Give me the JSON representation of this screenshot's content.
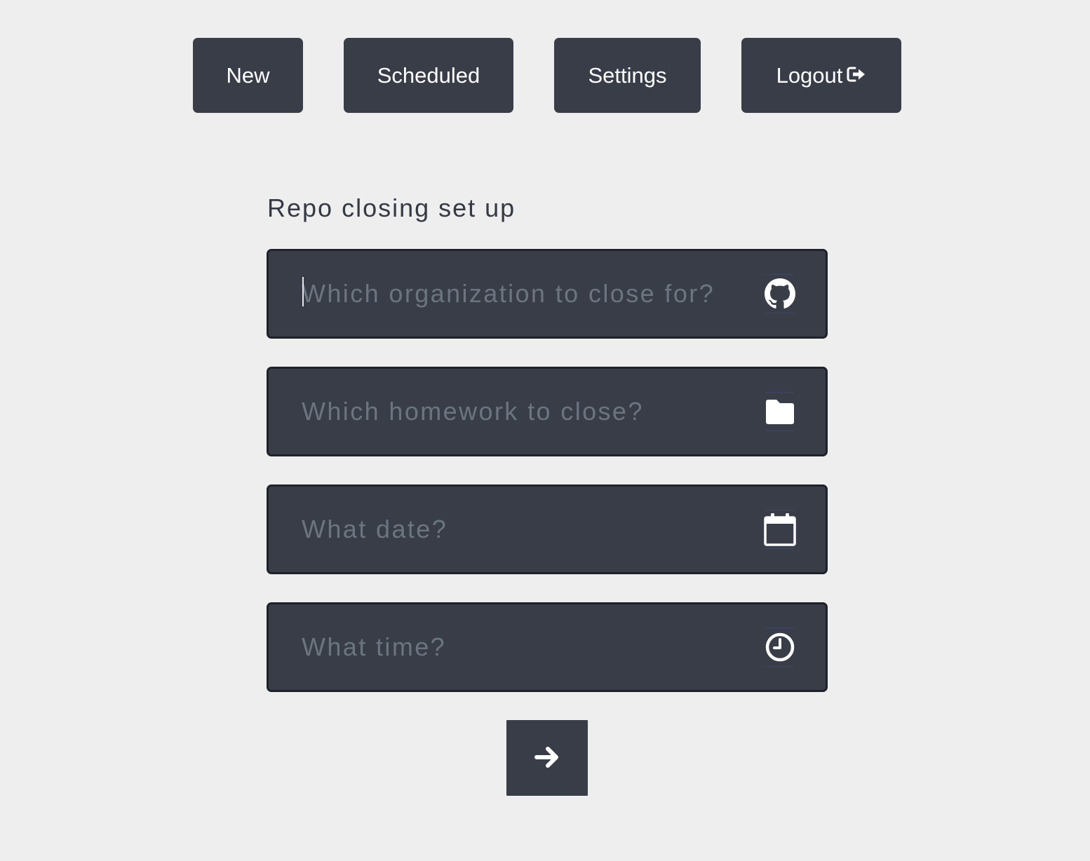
{
  "nav": {
    "new_label": "New",
    "scheduled_label": "Scheduled",
    "settings_label": "Settings",
    "logout_label": "Logout",
    "logout_icon": "sign-out-icon"
  },
  "form": {
    "title": "Repo closing set up",
    "fields": [
      {
        "placeholder": "Which organization to close for?",
        "value": "",
        "icon": "github-icon",
        "focused": true
      },
      {
        "placeholder": "Which homework to close?",
        "value": "",
        "icon": "folder-icon"
      },
      {
        "placeholder": "What date?",
        "value": "",
        "icon": "calendar-icon"
      },
      {
        "placeholder": "What time?",
        "value": "",
        "icon": "clock-icon"
      }
    ],
    "submit_icon": "arrow-right-icon"
  },
  "colors": {
    "background": "#eeeeee",
    "button": "#393d48",
    "field_border": "#1f2229",
    "placeholder": "#6b7580",
    "title": "#353944"
  }
}
